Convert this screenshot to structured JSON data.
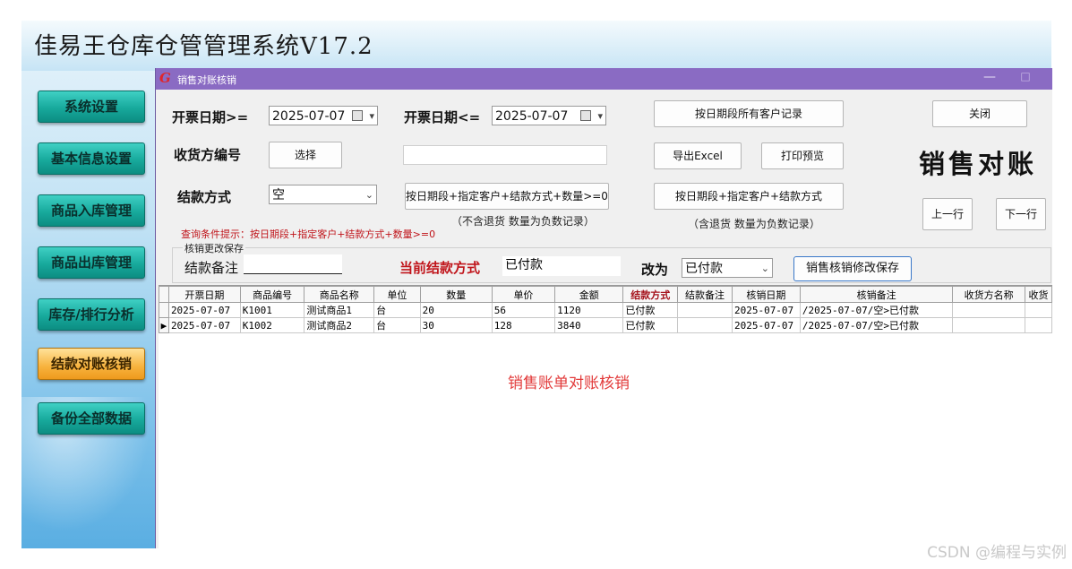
{
  "app": {
    "title": "佳易王仓库仓管管理系统V17.2",
    "nav": [
      "系统设置",
      "基本信息设置",
      "商品入库管理",
      "商品出库管理",
      "库存/排行分析",
      "结款对账核销",
      "备份全部数据"
    ]
  },
  "window": {
    "title": "销售对账核销",
    "logo": "G",
    "minimize": "—",
    "maximize": "□"
  },
  "form": {
    "date_from_label": "开票日期>=",
    "date_from_value": "2025-07-07",
    "date_to_label": "开票日期<=",
    "date_to_value": "2025-07-07",
    "btn_all_customers": "按日期段所有客户记录",
    "btn_close": "关闭",
    "receiver_label": "收货方编号",
    "btn_choose": "选择",
    "btn_export": "导出Excel",
    "btn_print": "打印预览",
    "big_title": "销售对账",
    "pay_label": "结款方式",
    "pay_value": "空",
    "btn_query_qty": "按日期段+指定客户+结款方式+数量>=0",
    "btn_query_all": "按日期段+指定客户+结款方式",
    "note_qty": "（不含退货  数量为负数记录）",
    "note_all": "（含退货   数量为负数记录）",
    "btn_prev": "上一行",
    "btn_next": "下一行",
    "hint": "查询条件提示：按日期段+指定客户+结款方式+数量>=0"
  },
  "edit": {
    "legend": "核销更改保存",
    "remark_label": "结款备注",
    "current_label": "当前结款方式",
    "current_value": "已付款",
    "change_label": "改为",
    "change_value": "已付款",
    "btn_save": "销售核销修改保存"
  },
  "grid": {
    "columns": [
      "开票日期",
      "商品编号",
      "商品名称",
      "单位",
      "数量",
      "单价",
      "金额",
      "结款方式",
      "结款备注",
      "核销日期",
      "核销备注",
      "收货方名称",
      "收货"
    ],
    "rows": [
      [
        "2025-07-07",
        "K1001",
        "测试商品1",
        "台",
        "20",
        "56",
        "1120",
        "已付款",
        "",
        "2025-07-07",
        "/2025-07-07/空>已付款",
        "",
        ""
      ],
      [
        "2025-07-07",
        "K1002",
        "测试商品2",
        "台",
        "30",
        "128",
        "3840",
        "已付款",
        "",
        "2025-07-07",
        "/2025-07-07/空>已付款",
        "",
        ""
      ]
    ],
    "center_note": "销售账单对账核销"
  },
  "watermark": "CSDN @编程与实例"
}
